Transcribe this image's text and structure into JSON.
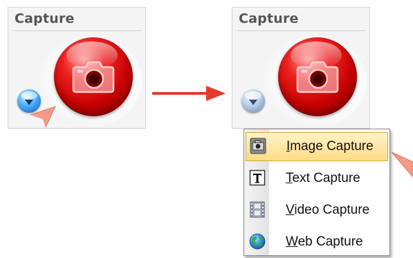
{
  "panels": [
    {
      "title": "Capture",
      "state": "collapsed"
    },
    {
      "title": "Capture",
      "state": "expanded"
    }
  ],
  "icons": {
    "capture_button": "camera-icon",
    "dropdown": "chevron-down-icon",
    "flow_arrow": "arrow-right-icon",
    "cursor": "pointer-cursor-icon"
  },
  "menu": {
    "items": [
      {
        "mnemonic": "I",
        "rest": "mage Capture",
        "icon": "image-capture-icon",
        "highlighted": true
      },
      {
        "mnemonic": "T",
        "rest": "ext Capture",
        "icon": "text-capture-icon",
        "highlighted": false
      },
      {
        "mnemonic": "V",
        "rest": "ideo Capture",
        "icon": "video-capture-icon",
        "highlighted": false
      },
      {
        "mnemonic": "W",
        "rest": "eb Capture",
        "icon": "web-capture-icon",
        "highlighted": false
      }
    ]
  },
  "colors": {
    "capture_red": "#d10000",
    "arrow_red": "#e53a2a",
    "highlight_top": "#fff4c8",
    "highlight_bottom": "#ffdc84",
    "cursor_fill": "#f39a86",
    "dropdown_blue_active": "#3a96f0",
    "dropdown_blue_inactive": "#9fb6d4"
  }
}
